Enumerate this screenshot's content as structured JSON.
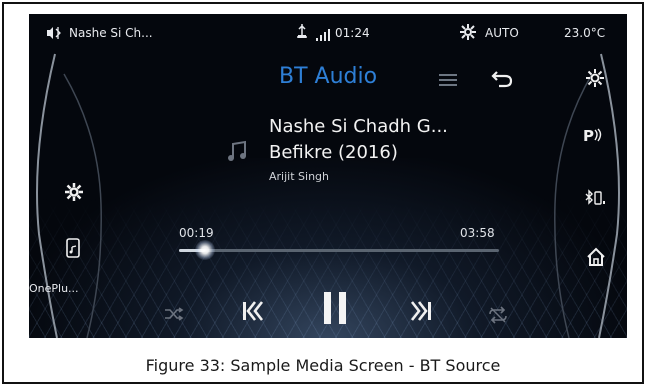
{
  "status_bar": {
    "track_short": "Nashe Si Ch...",
    "time": "01:24",
    "climate_mode": "AUTO",
    "temperature": "23.0°C"
  },
  "source_title": "BT Audio",
  "now_playing": {
    "song": "Nashe Si Chadh G...",
    "album": "Befikre (2016)",
    "artist": "Arijit Singh"
  },
  "progress": {
    "elapsed": "00:19",
    "total": "03:58",
    "fraction": 0.08
  },
  "left_panel": {
    "device_label": "OnePlu..."
  },
  "caption": "Figure 33: Sample Media Screen - BT Source",
  "colors": {
    "accent": "#2e7fd6",
    "background": "#04070d"
  }
}
